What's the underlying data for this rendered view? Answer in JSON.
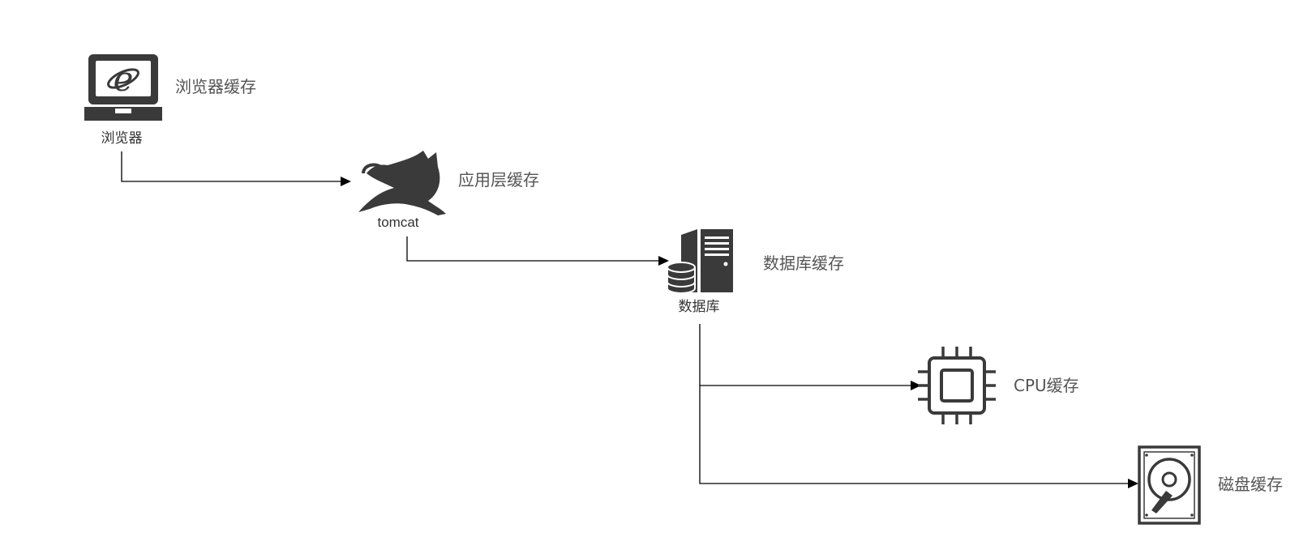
{
  "nodes": {
    "browser": {
      "label": "浏览器",
      "cache": "浏览器缓存",
      "icon": "laptop-browser-icon"
    },
    "tomcat": {
      "label": "tomcat",
      "cache": "应用层缓存",
      "icon": "tomcat-cat-icon"
    },
    "database": {
      "label": "数据库",
      "cache": "数据库缓存",
      "icon": "database-server-icon"
    },
    "cpu": {
      "cache": "CPU缓存",
      "icon": "cpu-chip-icon"
    },
    "disk": {
      "cache": "磁盘缓存",
      "icon": "hard-disk-icon"
    }
  },
  "edges": [
    {
      "from": "browser",
      "to": "tomcat"
    },
    {
      "from": "tomcat",
      "to": "database"
    },
    {
      "from": "database",
      "to": "cpu"
    },
    {
      "from": "database",
      "to": "disk"
    }
  ],
  "colors": {
    "icon": "#3a3a3a",
    "text": "#333333",
    "cache_text": "#555555",
    "edge": "#000000"
  }
}
